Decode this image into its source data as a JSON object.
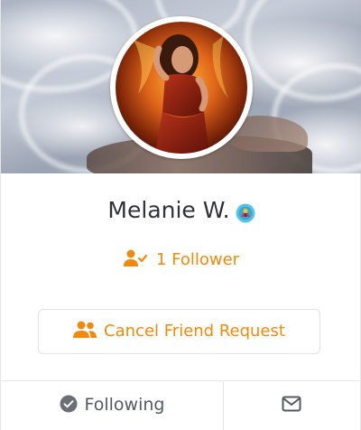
{
  "profile": {
    "name": "Melanie W.",
    "followers_label": "1 Follower"
  },
  "actions": {
    "cancel_request_label": "Cancel Friend Request",
    "following_label": "Following"
  },
  "icons": {
    "badge": "superhero-badge-icon",
    "followers": "user-check-icon",
    "cancel": "users-icon",
    "following": "check-circle-icon",
    "message": "envelope-icon"
  },
  "colors": {
    "accent": "#f08a0c",
    "text": "#2f3136",
    "muted": "#55595f",
    "border": "#e6e6e6"
  }
}
